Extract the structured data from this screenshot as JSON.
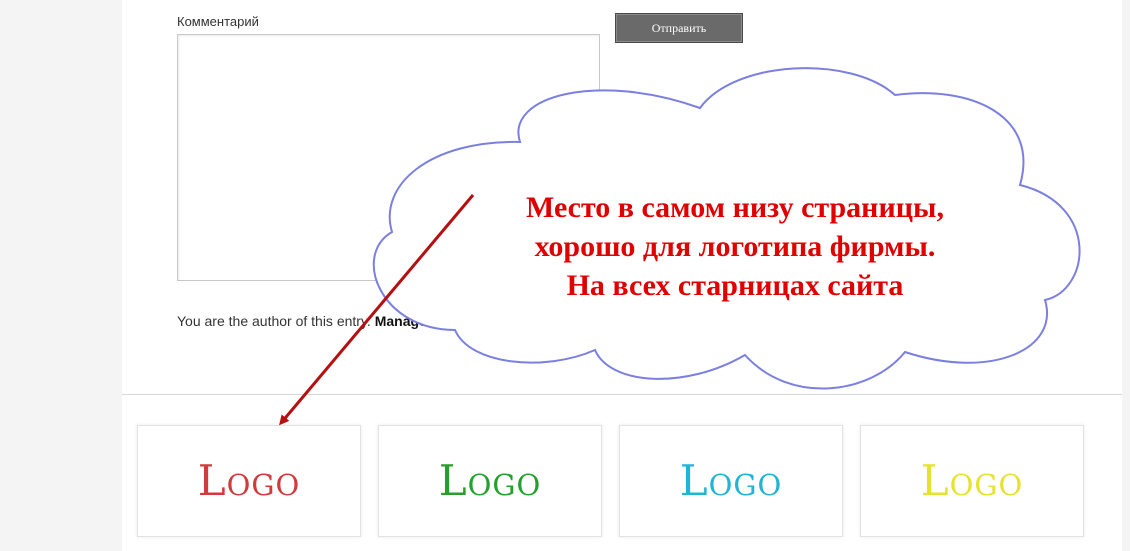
{
  "comment_form": {
    "label": "Комментарий",
    "textarea_value": "",
    "submit_label": "Отправить"
  },
  "author_note": {
    "text": "You are the author of this entry.",
    "link_label": "Manage"
  },
  "annotation": {
    "line1": "Место в самом низу страницы,",
    "line2": "хорошо для логотипа фирмы.",
    "line3": "На всех старницах сайта",
    "text_color": "#e00000",
    "cloud_stroke": "#7b7fe0",
    "arrow_color": "#b50f0f"
  },
  "logos": [
    {
      "label": "Logo",
      "color": "#d23b3b"
    },
    {
      "label": "Logo",
      "color": "#24a12c"
    },
    {
      "label": "Logo",
      "color": "#22b4d4"
    },
    {
      "label": "Logo",
      "color": "#e6e230"
    }
  ]
}
